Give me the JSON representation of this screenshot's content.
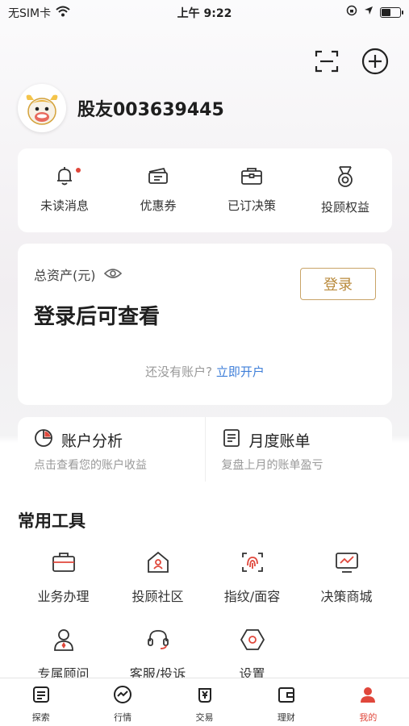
{
  "status_bar": {
    "carrier": "无SIM卡",
    "time": "上午 9:22"
  },
  "header": {
    "scan_icon": "scan-icon",
    "add_icon": "plus-circle-icon"
  },
  "profile": {
    "username": "股友003639445"
  },
  "quick_actions": [
    {
      "label": "未读消息",
      "icon": "bell-icon",
      "has_dot": true
    },
    {
      "label": "优惠券",
      "icon": "coupon-icon"
    },
    {
      "label": "已订决策",
      "icon": "briefcase-icon"
    },
    {
      "label": "投顾权益",
      "icon": "medal-icon"
    }
  ],
  "assets": {
    "title": "总资产(元)",
    "value": "登录后可查看",
    "login_label": "登录",
    "no_account_text": "还没有账户?",
    "open_account_link": "立即开户"
  },
  "analysis": [
    {
      "title": "账户分析",
      "subtitle": "点击查看您的账户收益",
      "icon": "pie-chart-icon"
    },
    {
      "title": "月度账单",
      "subtitle": "复盘上月的账单盈亏",
      "icon": "bill-icon"
    }
  ],
  "tools": {
    "title": "常用工具",
    "items": [
      {
        "label": "业务办理",
        "icon": "briefcase-icon"
      },
      {
        "label": "投顾社区",
        "icon": "community-house-icon"
      },
      {
        "label": "指纹/面容",
        "icon": "fingerprint-icon"
      },
      {
        "label": "决策商城",
        "icon": "monitor-chart-icon"
      },
      {
        "label": "专属顾问",
        "icon": "advisor-icon"
      },
      {
        "label": "客服/投诉",
        "icon": "headset-icon"
      },
      {
        "label": "设置",
        "icon": "settings-hexagon-icon"
      }
    ]
  },
  "tabbar": [
    {
      "label": "探索",
      "icon": "explore-icon"
    },
    {
      "label": "行情",
      "icon": "market-icon"
    },
    {
      "label": "交易",
      "icon": "trade-icon"
    },
    {
      "label": "理财",
      "icon": "wallet-icon"
    },
    {
      "label": "我的",
      "icon": "profile-icon",
      "active": true
    }
  ],
  "colors": {
    "accent": "#e0473b",
    "gold": "#b98a3c",
    "link": "#3f7fd9"
  }
}
